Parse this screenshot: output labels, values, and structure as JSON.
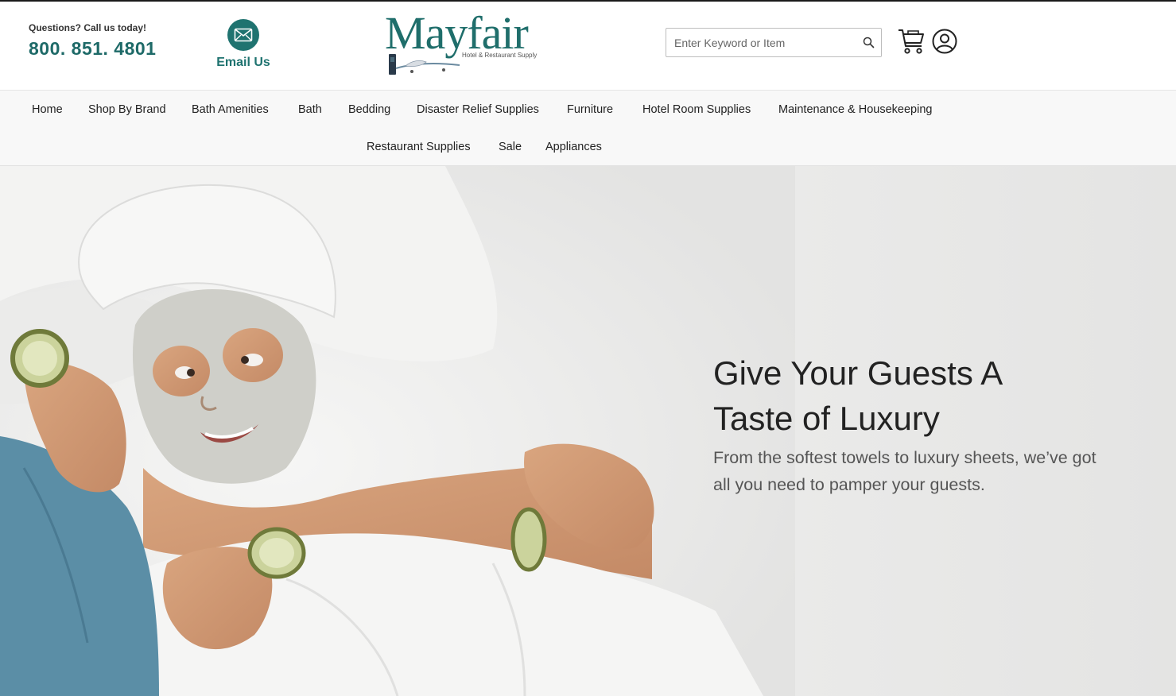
{
  "header": {
    "contact_label": "Questions? Call us today!",
    "phone": "800. 851. 4801",
    "email_label": "Email Us",
    "logo_word": "Mayfair",
    "logo_tagline": "Hotel & Restaurant Supply",
    "search_placeholder": "Enter Keyword or Item"
  },
  "nav": {
    "row1": [
      "Home",
      "Shop By Brand",
      "Bath Amenities",
      "Bath",
      "Bedding",
      "Disaster Relief Supplies",
      "Furniture",
      "Hotel Room Supplies",
      "Maintenance & Housekeeping"
    ],
    "row2": [
      "Restaurant Supplies",
      "Sale",
      "Appliances"
    ]
  },
  "hero": {
    "title_line1": "Give Your Guests A",
    "title_line2": "Taste of Luxury",
    "subtitle_line1": "From the softest towels to luxury sheets, we’ve got",
    "subtitle_line2": "all you need to pamper your guests."
  },
  "colors": {
    "brand_teal": "#1f7370",
    "nav_background": "#f8f8f8",
    "hero_background": "#ececeb"
  },
  "icons": [
    "envelope-icon",
    "search-icon",
    "shopping-cart-icon",
    "user-account-icon",
    "bellhop-cart-logo-icon"
  ]
}
